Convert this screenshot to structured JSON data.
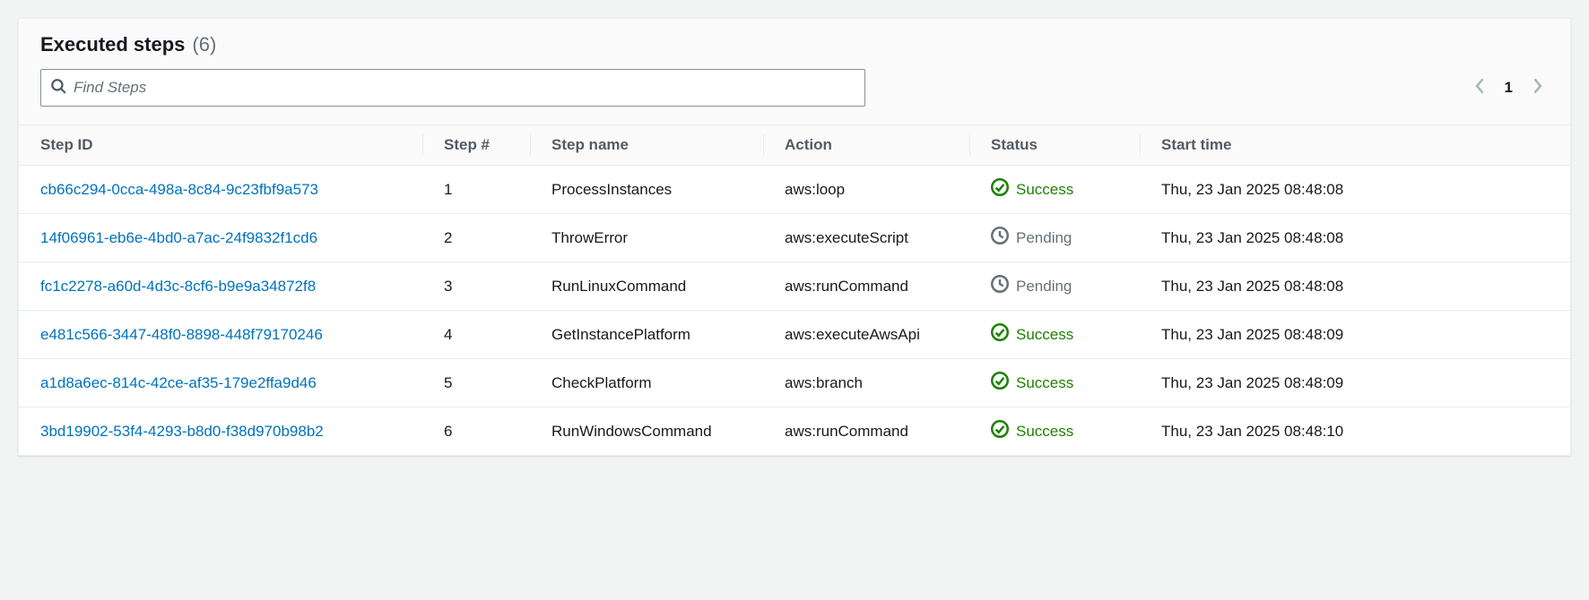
{
  "panel": {
    "title": "Executed steps",
    "count": "(6)"
  },
  "search": {
    "placeholder": "Find Steps"
  },
  "pager": {
    "page": "1"
  },
  "columns": {
    "step_id": "Step ID",
    "step_num": "Step #",
    "step_name": "Step name",
    "action": "Action",
    "status": "Status",
    "start_time": "Start time"
  },
  "rows": [
    {
      "id": "cb66c294-0cca-498a-8c84-9c23fbf9a573",
      "num": "1",
      "name": "ProcessInstances",
      "action": "aws:loop",
      "status": "Success",
      "status_kind": "success",
      "start_time": "Thu, 23 Jan 2025 08:48:08"
    },
    {
      "id": "14f06961-eb6e-4bd0-a7ac-24f9832f1cd6",
      "num": "2",
      "name": "ThrowError",
      "action": "aws:executeScript",
      "status": "Pending",
      "status_kind": "pending",
      "start_time": "Thu, 23 Jan 2025 08:48:08"
    },
    {
      "id": "fc1c2278-a60d-4d3c-8cf6-b9e9a34872f8",
      "num": "3",
      "name": "RunLinuxCommand",
      "action": "aws:runCommand",
      "status": "Pending",
      "status_kind": "pending",
      "start_time": "Thu, 23 Jan 2025 08:48:08"
    },
    {
      "id": "e481c566-3447-48f0-8898-448f79170246",
      "num": "4",
      "name": "GetInstancePlatform",
      "action": "aws:executeAwsApi",
      "status": "Success",
      "status_kind": "success",
      "start_time": "Thu, 23 Jan 2025 08:48:09"
    },
    {
      "id": "a1d8a6ec-814c-42ce-af35-179e2ffa9d46",
      "num": "5",
      "name": "CheckPlatform",
      "action": "aws:branch",
      "status": "Success",
      "status_kind": "success",
      "start_time": "Thu, 23 Jan 2025 08:48:09"
    },
    {
      "id": "3bd19902-53f4-4293-b8d0-f38d970b98b2",
      "num": "6",
      "name": "RunWindowsCommand",
      "action": "aws:runCommand",
      "status": "Success",
      "status_kind": "success",
      "start_time": "Thu, 23 Jan 2025 08:48:10"
    }
  ]
}
